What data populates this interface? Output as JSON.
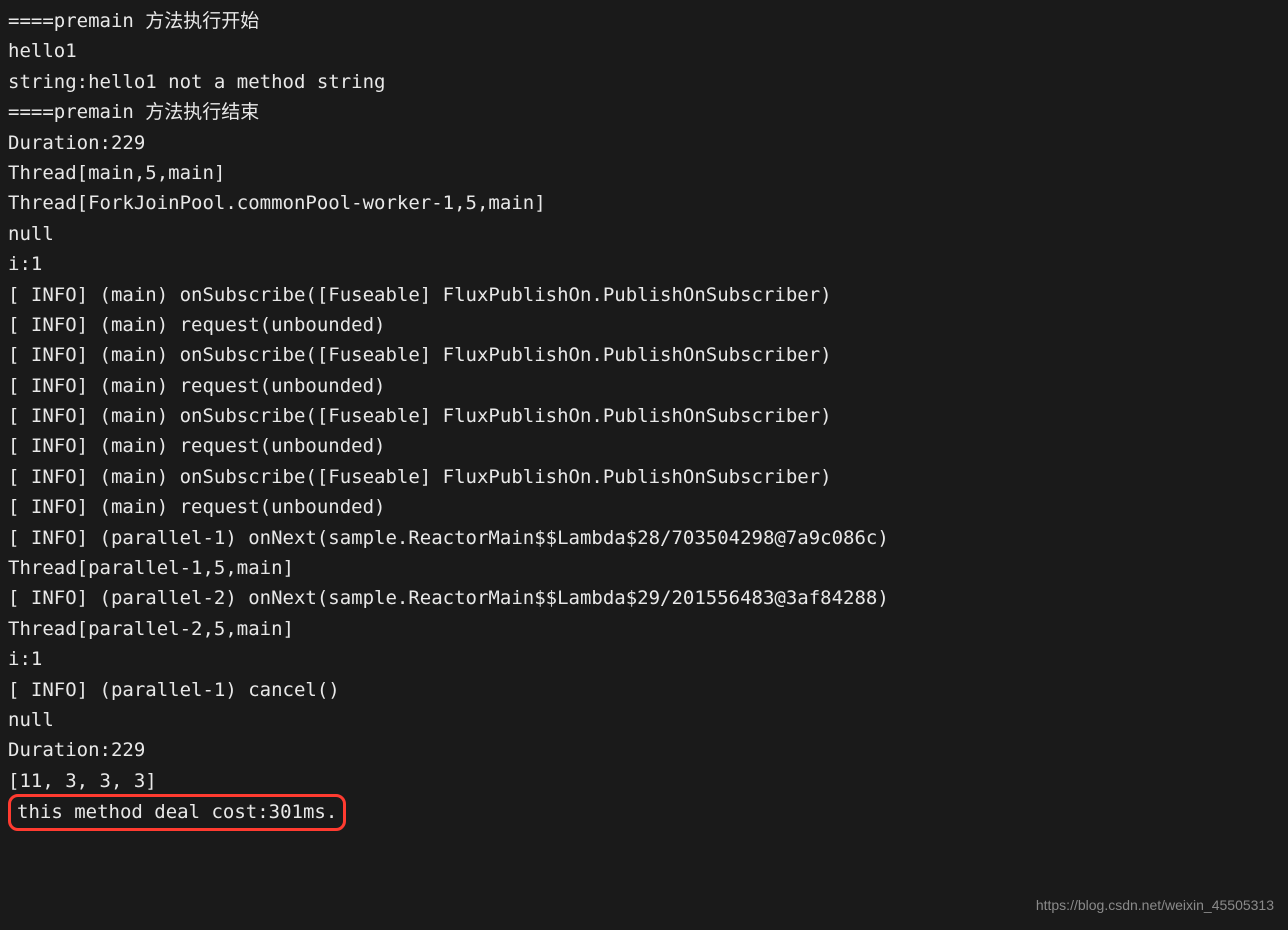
{
  "lines": [
    "====premain 方法执行开始",
    "hello1",
    "string:hello1 not a method string",
    "====premain 方法执行结束",
    "Duration:229",
    "Thread[main,5,main]",
    "Thread[ForkJoinPool.commonPool-worker-1,5,main]",
    "null",
    "i:1",
    "[ INFO] (main) onSubscribe([Fuseable] FluxPublishOn.PublishOnSubscriber)",
    "[ INFO] (main) request(unbounded)",
    "[ INFO] (main) onSubscribe([Fuseable] FluxPublishOn.PublishOnSubscriber)",
    "[ INFO] (main) request(unbounded)",
    "[ INFO] (main) onSubscribe([Fuseable] FluxPublishOn.PublishOnSubscriber)",
    "[ INFO] (main) request(unbounded)",
    "[ INFO] (main) onSubscribe([Fuseable] FluxPublishOn.PublishOnSubscriber)",
    "[ INFO] (main) request(unbounded)",
    "[ INFO] (parallel-1) onNext(sample.ReactorMain$$Lambda$28/703504298@7a9c086c)",
    "Thread[parallel-1,5,main]",
    "[ INFO] (parallel-2) onNext(sample.ReactorMain$$Lambda$29/201556483@3af84288)",
    "Thread[parallel-2,5,main]",
    "i:1",
    "[ INFO] (parallel-1) cancel()",
    "null",
    "Duration:229",
    "[11, 3, 3, 3]"
  ],
  "highlighted_line": "this method deal cost:301ms.",
  "watermark": "https://blog.csdn.net/weixin_45505313"
}
